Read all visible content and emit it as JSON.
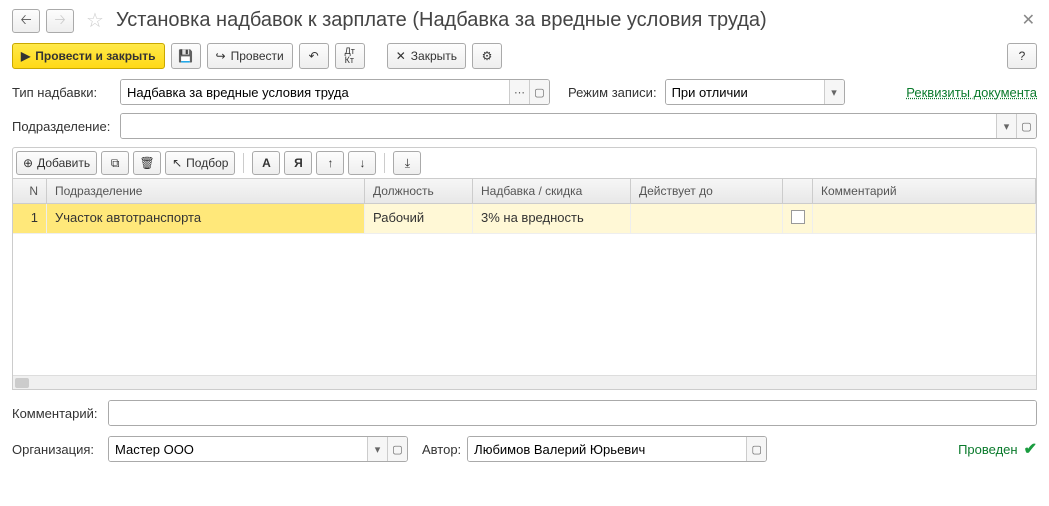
{
  "header": {
    "title": "Установка надбавок к зарплате (Надбавка за вредные условия труда)"
  },
  "toolbar": {
    "post_close": "Провести и закрыть",
    "post": "Провести",
    "close": "Закрыть"
  },
  "form": {
    "type_label": "Тип надбавки:",
    "type_value": "Надбавка за вредные условия труда",
    "mode_label": "Режим записи:",
    "mode_value": "При отличии",
    "details_link": "Реквизиты документа",
    "dept_label": "Подразделение:",
    "dept_value": ""
  },
  "grid_toolbar": {
    "add": "Добавить",
    "select": "Подбор"
  },
  "grid": {
    "headers": {
      "n": "N",
      "dept": "Подразделение",
      "pos": "Должность",
      "allow": "Надбавка / скидка",
      "until": "Действует до",
      "comm": "Комментарий"
    },
    "rows": [
      {
        "n": "1",
        "dept": "Участок автотранспорта",
        "pos": "Рабочий",
        "allow": "3% на вредность",
        "until": "",
        "chk": false,
        "comm": ""
      }
    ]
  },
  "footer": {
    "comment_label": "Комментарий:",
    "comment_value": "",
    "org_label": "Организация:",
    "org_value": "Мастер ООО",
    "author_label": "Автор:",
    "author_value": "Любимов Валерий Юрьевич",
    "status": "Проведен"
  }
}
